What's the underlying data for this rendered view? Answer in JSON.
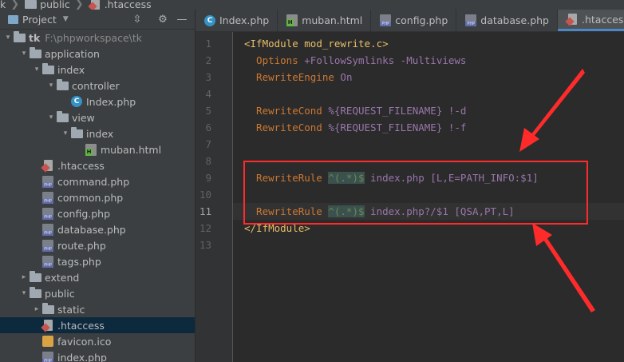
{
  "breadcrumb": {
    "items": [
      "k",
      "public",
      ".htaccess"
    ],
    "icons": [
      "folder-icon",
      "folder-icon",
      "htaccess-icon"
    ]
  },
  "project_panel": {
    "title": "Project",
    "tree": [
      {
        "label": "tk",
        "path": "F:\\phpworkspace\\tk",
        "icon": "folder",
        "arrow": "▾"
      },
      {
        "label": "application",
        "icon": "folder",
        "arrow": "▾"
      },
      {
        "label": "index",
        "icon": "folder",
        "arrow": "▾"
      },
      {
        "label": "controller",
        "icon": "folder",
        "arrow": "▾"
      },
      {
        "label": "Index.php",
        "icon": "class",
        "arrow": ""
      },
      {
        "label": "view",
        "icon": "folder",
        "arrow": "▾"
      },
      {
        "label": "index",
        "icon": "folder",
        "arrow": "▾"
      },
      {
        "label": "muban.html",
        "icon": "html",
        "arrow": ""
      },
      {
        "label": ".htaccess",
        "icon": "htaccess",
        "arrow": ""
      },
      {
        "label": "command.php",
        "icon": "php",
        "arrow": ""
      },
      {
        "label": "common.php",
        "icon": "php",
        "arrow": ""
      },
      {
        "label": "config.php",
        "icon": "php",
        "arrow": ""
      },
      {
        "label": "database.php",
        "icon": "php",
        "arrow": ""
      },
      {
        "label": "route.php",
        "icon": "php",
        "arrow": ""
      },
      {
        "label": "tags.php",
        "icon": "php",
        "arrow": ""
      },
      {
        "label": "extend",
        "icon": "folder",
        "arrow": "▸"
      },
      {
        "label": "public",
        "icon": "folder",
        "arrow": "▾"
      },
      {
        "label": "static",
        "icon": "folder",
        "arrow": "▸"
      },
      {
        "label": ".htaccess",
        "icon": "htaccess",
        "arrow": "",
        "selected": true
      },
      {
        "label": "favicon.ico",
        "icon": "ico",
        "arrow": ""
      },
      {
        "label": "index.php",
        "icon": "php",
        "arrow": ""
      }
    ]
  },
  "tabs": [
    {
      "label": "Index.php",
      "icon": "class"
    },
    {
      "label": "muban.html",
      "icon": "html"
    },
    {
      "label": "config.php",
      "icon": "php"
    },
    {
      "label": "database.php",
      "icon": "php"
    },
    {
      "label": ".htaccess",
      "icon": "htaccess",
      "active": true
    }
  ],
  "editor": {
    "current_line": 11,
    "line_numbers": [
      "1",
      "2",
      "3",
      "4",
      "5",
      "6",
      "7",
      "8",
      "9",
      "10",
      "11",
      "12",
      "13"
    ],
    "lines": [
      [
        {
          "t": "<IfModule ",
          "c": "tag"
        },
        {
          "t": "mod_rewrite.c",
          "c": "tag"
        },
        {
          "t": ">",
          "c": "tag"
        }
      ],
      [
        {
          "t": "  Options ",
          "c": "dir"
        },
        {
          "t": "+FollowSymlinks -Multiviews",
          "c": "arg"
        }
      ],
      [
        {
          "t": "  RewriteEngine ",
          "c": "dir"
        },
        {
          "t": "On",
          "c": "arg"
        }
      ],
      [],
      [
        {
          "t": "  RewriteCond ",
          "c": "dir"
        },
        {
          "t": "%{REQUEST_FILENAME} !-d",
          "c": "arg"
        }
      ],
      [
        {
          "t": "  RewriteCond ",
          "c": "dir"
        },
        {
          "t": "%{REQUEST_FILENAME} !-f",
          "c": "arg"
        }
      ],
      [],
      [],
      [
        {
          "t": "  RewriteRule ",
          "c": "dir"
        },
        {
          "t": "^(.*)$",
          "c": "re"
        },
        {
          "t": " index.php [L,E=PATH_INFO:$1]",
          "c": "arg"
        }
      ],
      [],
      [
        {
          "t": "  RewriteRule ",
          "c": "dir"
        },
        {
          "t": "^(.*)$",
          "c": "re"
        },
        {
          "t": " index.php?/$1 [QSA,PT,L]",
          "c": "arg"
        }
      ],
      [
        {
          "t": "</IfModule>",
          "c": "tag"
        }
      ],
      []
    ]
  },
  "colors": {
    "highlight_box": "#ff2b2b",
    "annotation_arrows": "#ff2b2b",
    "selection": "#0d293e"
  }
}
